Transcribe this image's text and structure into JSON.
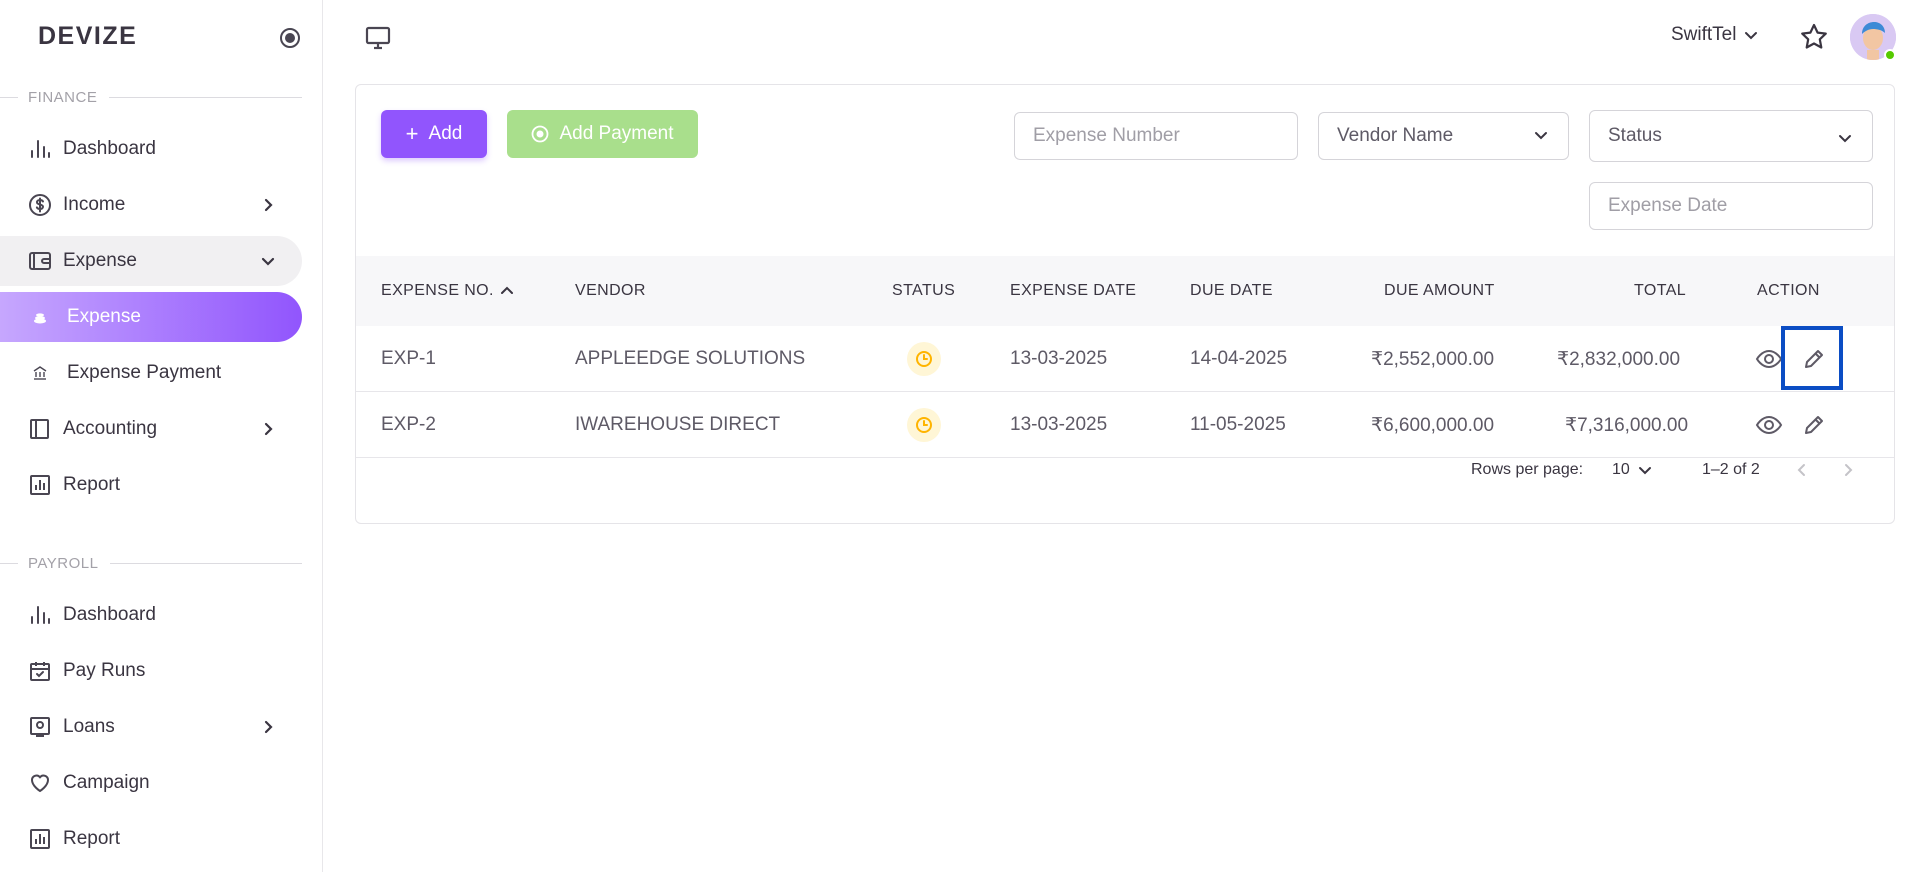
{
  "brand": "DEVIZE",
  "sidebar": {
    "finance_label": "FINANCE",
    "payroll_label": "PAYROLL",
    "finance_items": [
      {
        "label": "Dashboard",
        "icon": "bar-chart-icon"
      },
      {
        "label": "Income",
        "icon": "dollar-circle-icon"
      },
      {
        "label": "Expense",
        "icon": "wallet-icon"
      },
      {
        "label": "Expense",
        "icon": "coins-icon"
      },
      {
        "label": "Expense Payment",
        "icon": "bank-icon"
      },
      {
        "label": "Accounting",
        "icon": "book-icon"
      },
      {
        "label": "Report",
        "icon": "report-icon"
      }
    ],
    "payroll_items": [
      {
        "label": "Dashboard",
        "icon": "bar-chart-icon"
      },
      {
        "label": "Pay Runs",
        "icon": "calendar-check-icon"
      },
      {
        "label": "Loans",
        "icon": "loan-icon"
      },
      {
        "label": "Campaign",
        "icon": "heart-icon"
      },
      {
        "label": "Report",
        "icon": "report-icon"
      }
    ]
  },
  "topbar": {
    "company": "SwiftTel"
  },
  "toolbar": {
    "add_label": "Add",
    "add_payment_label": "Add Payment"
  },
  "filters": {
    "expense_number_placeholder": "Expense Number",
    "vendor_name": "Vendor Name",
    "status": "Status",
    "expense_date_placeholder": "Expense Date"
  },
  "table": {
    "columns": [
      "EXPENSE NO.",
      "VENDOR",
      "STATUS",
      "EXPENSE DATE",
      "DUE DATE",
      "DUE AMOUNT",
      "TOTAL",
      "ACTION"
    ],
    "rows": [
      {
        "expense_no": "EXP-1",
        "vendor": "APPLEEDGE SOLUTIONS",
        "status": "pending",
        "expense_date": "13-03-2025",
        "due_date": "14-04-2025",
        "due_amount": "₹2,552,000.00",
        "total": "₹2,832,000.00"
      },
      {
        "expense_no": "EXP-2",
        "vendor": "IWAREHOUSE DIRECT",
        "status": "pending",
        "expense_date": "13-03-2025",
        "due_date": "11-05-2025",
        "due_amount": "₹6,600,000.00",
        "total": "₹7,316,000.00"
      }
    ]
  },
  "pagination": {
    "rows_per_page_label": "Rows per page:",
    "rows_per_page": "10",
    "range": "1–2 of 2"
  },
  "colors": {
    "primary": "#9155fd",
    "success_light": "#a9df8c",
    "warning": "#ffb400"
  }
}
